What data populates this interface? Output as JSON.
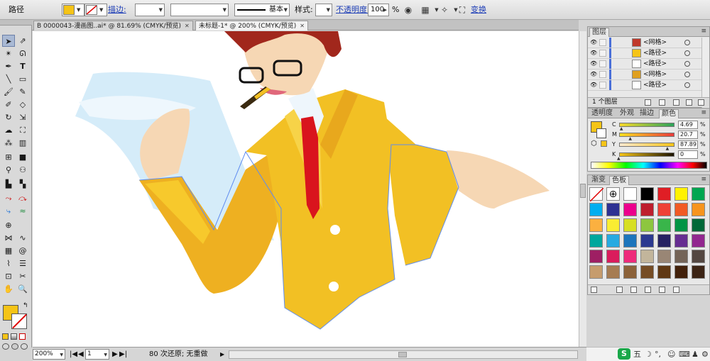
{
  "control_bar": {
    "object_type": "路径",
    "fill_color": "#f5c417",
    "stroke_label": "描边:",
    "stroke_width": "",
    "profile_value": "",
    "brush_name": "基本",
    "style_label": "样式:",
    "opacity_label": "不透明度:",
    "opacity_value": "100",
    "opacity_unit": "%",
    "transform_label": "变换"
  },
  "document_tabs": [
    {
      "label": "B 0000043-漫画图..ai* @ 81.69% (CMYK/预览)",
      "active": false
    },
    {
      "label": "未标题-1* @ 200% (CMYK/预览)",
      "active": true
    }
  ],
  "tools": {
    "fill_color": "#f5c417",
    "icons": [
      "selection-icon",
      "direct-selection-icon",
      "magic-wand-icon",
      "lasso-icon",
      "pen-icon",
      "type-icon",
      "line-icon",
      "rectangle-icon",
      "paintbrush-icon",
      "pencil-icon",
      "blob-brush-icon",
      "eraser-icon",
      "rotate-icon",
      "scale-icon",
      "warp-icon",
      "free-transform-icon",
      "symbol-sprayer-icon",
      "column-graph-icon",
      "mesh-icon",
      "gradient-icon",
      "eyedropper-icon",
      "blend-icon",
      "live-paint-icon",
      "live-paint-select-icon",
      "artboard-icon",
      "slice-icon",
      "hand-icon",
      "zoom-icon"
    ]
  },
  "status_bar": {
    "zoom": "200%",
    "artboard": "1",
    "history": "80 次还原; 无重做"
  },
  "layers_panel": {
    "tab": "图层",
    "rows": [
      {
        "name": "<网格>",
        "thumb_color": "#c0392b"
      },
      {
        "name": "<路径>",
        "thumb_color": "#f5c417"
      },
      {
        "name": "<路径>",
        "thumb_color": "#ffffff"
      },
      {
        "name": "<网格>",
        "thumb_color": "#e0a020"
      },
      {
        "name": "<路径>",
        "thumb_color": "#ffffff"
      }
    ],
    "footer": "1 个图层"
  },
  "color_panel": {
    "tabs": [
      "透明度",
      "外观",
      "描边",
      "颜色"
    ],
    "active_tab": "颜色",
    "fill_color": "#f5c417",
    "channels": [
      {
        "label": "C",
        "value": "4.69",
        "pos": 0.05,
        "gradient": "linear-gradient(90deg,#f7d92a,#2ca35b)"
      },
      {
        "label": "M",
        "value": "20.7",
        "pos": 0.21,
        "gradient": "linear-gradient(90deg,#f9e020,#e83a3a)"
      },
      {
        "label": "Y",
        "value": "87.89",
        "pos": 0.88,
        "gradient": "linear-gradient(90deg,#fde9d0,#f5c417)"
      },
      {
        "label": "K",
        "value": "0",
        "pos": 0.0,
        "gradient": "linear-gradient(90deg,#f5c417,#1b1300)"
      }
    ],
    "unit": "%"
  },
  "swatches_panel": {
    "tabs": [
      "渐变",
      "色板"
    ],
    "active_tab": "色板",
    "swatches": [
      "none",
      "registration",
      "#ffffff",
      "#000000",
      "#e01e25",
      "#fff200",
      "#00a651",
      "#00aeef",
      "#2e3192",
      "#ec008c",
      "#be1e2d",
      "#ef4136",
      "#f15a24",
      "#f7941d",
      "#fbb040",
      "#f9ed32",
      "#d7df23",
      "#8dc63f",
      "#39b54a",
      "#009444",
      "#006838",
      "#00a79d",
      "#27aae1",
      "#1c75bc",
      "#2b3990",
      "#262262",
      "#662d91",
      "#92278f",
      "#9e1f63",
      "#da1c5c",
      "#ee2a7b",
      "#c2b59b",
      "#998675",
      "#736357",
      "#534741",
      "#c69c6d",
      "#a67c52",
      "#8c6239",
      "#754c24",
      "#603813",
      "#42210b",
      "#3c2415"
    ]
  },
  "ime_bar": {
    "logo": "S",
    "mode": "五"
  }
}
